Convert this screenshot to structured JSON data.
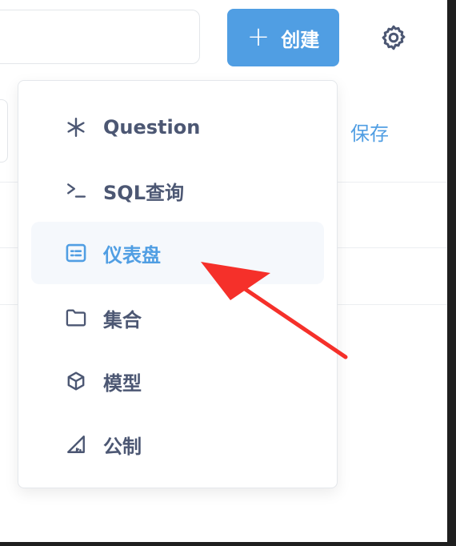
{
  "header": {
    "create_label": "创建",
    "plus_glyph": "+"
  },
  "toolbar": {
    "save_label": "保存"
  },
  "new_menu": {
    "items": [
      {
        "label": "Question",
        "icon": "asterisk-icon"
      },
      {
        "label": "SQL查询",
        "icon": "terminal-icon"
      },
      {
        "label": "仪表盘",
        "icon": "dashboard-icon",
        "highlighted": true
      },
      {
        "label": "集合",
        "icon": "folder-icon"
      },
      {
        "label": "模型",
        "icon": "cube-icon"
      },
      {
        "label": "公制",
        "icon": "ruler-triangle-icon"
      }
    ]
  },
  "colors": {
    "accent": "#509ee3",
    "text": "#4c5773",
    "highlight_bg": "#f5f8fc",
    "annotation_arrow": "#f5302a"
  }
}
